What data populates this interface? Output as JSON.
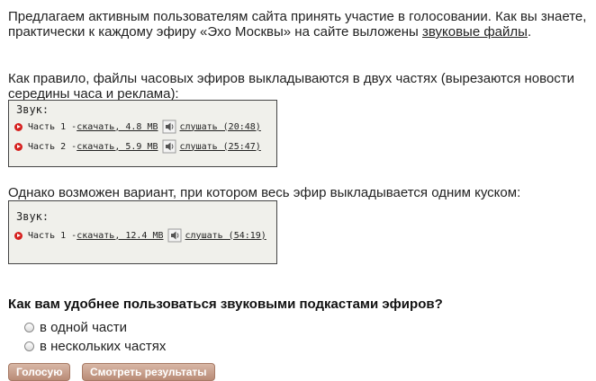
{
  "intro": {
    "text": "Предлагаем активным пользователям сайта принять участие в голосовании. Как вы знаете, практически к каждому эфиру «Эхо Москвы» на сайте выложены ",
    "link": "звуковые файлы",
    "tail": "."
  },
  "paragraph2": "Как правило, файлы часовых эфиров выкладываются в двух частях (вырезаются новости середины часа и реклама):",
  "box1": {
    "title": "Звук:",
    "tracks": [
      {
        "part": "Часть 1 - ",
        "download": "скачать, 4.8 MB",
        "listen": "слушать (20:48)"
      },
      {
        "part": "Часть 2 - ",
        "download": "скачать, 5.9 MB",
        "listen": "слушать (25:47)"
      }
    ]
  },
  "paragraph3": "Однако возможен вариант, при котором весь эфир выкладывается одним куском:",
  "box2": {
    "title": "Звук:",
    "tracks": [
      {
        "part": "Часть 1 - ",
        "download": "скачать, 12.4 MB",
        "listen": "слушать (54:19)"
      }
    ]
  },
  "poll": {
    "question": "Как вам удобнее пользоваться звуковыми подкастами эфиров?",
    "options": [
      "в одной части",
      "в нескольких частях"
    ],
    "vote_button": "Голосую",
    "results_button": "Смотреть результаты"
  },
  "colors": {
    "box_background": "#f0f0eb",
    "play_icon": "#d6211f",
    "button": "#c49a86"
  }
}
